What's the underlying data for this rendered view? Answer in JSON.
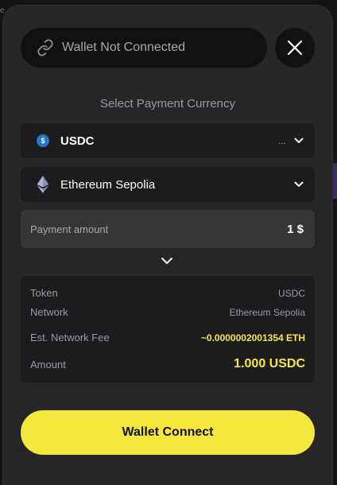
{
  "wallet": {
    "status_text": "Wallet Not Connected"
  },
  "section": {
    "title": "Select Payment Currency"
  },
  "currency": {
    "label": "USDC",
    "ellipsis": "..."
  },
  "network": {
    "label": "Ethereum Sepolia"
  },
  "payment": {
    "label": "Payment amount",
    "value": "1 $"
  },
  "summary": {
    "rows": [
      {
        "key": "Token",
        "value": "USDC"
      },
      {
        "key": "Network",
        "value": "Ethereum Sepolia"
      },
      {
        "key": "Est. Network Fee",
        "value": "~0.0000002001354 ETH"
      },
      {
        "key": "Amount",
        "value": "1.000 USDC"
      }
    ]
  },
  "actions": {
    "connect_label": "Wallet Connect"
  },
  "colors": {
    "accent": "#f5e83c",
    "modal_bg": "#262628",
    "field_bg": "#1c1c1e",
    "usdc_blue": "#2775ca"
  },
  "icons": {
    "link": "link-icon",
    "close": "close-icon",
    "usdc": "usdc-icon",
    "ethereum": "ethereum-icon",
    "chevron": "chevron-down-icon"
  }
}
